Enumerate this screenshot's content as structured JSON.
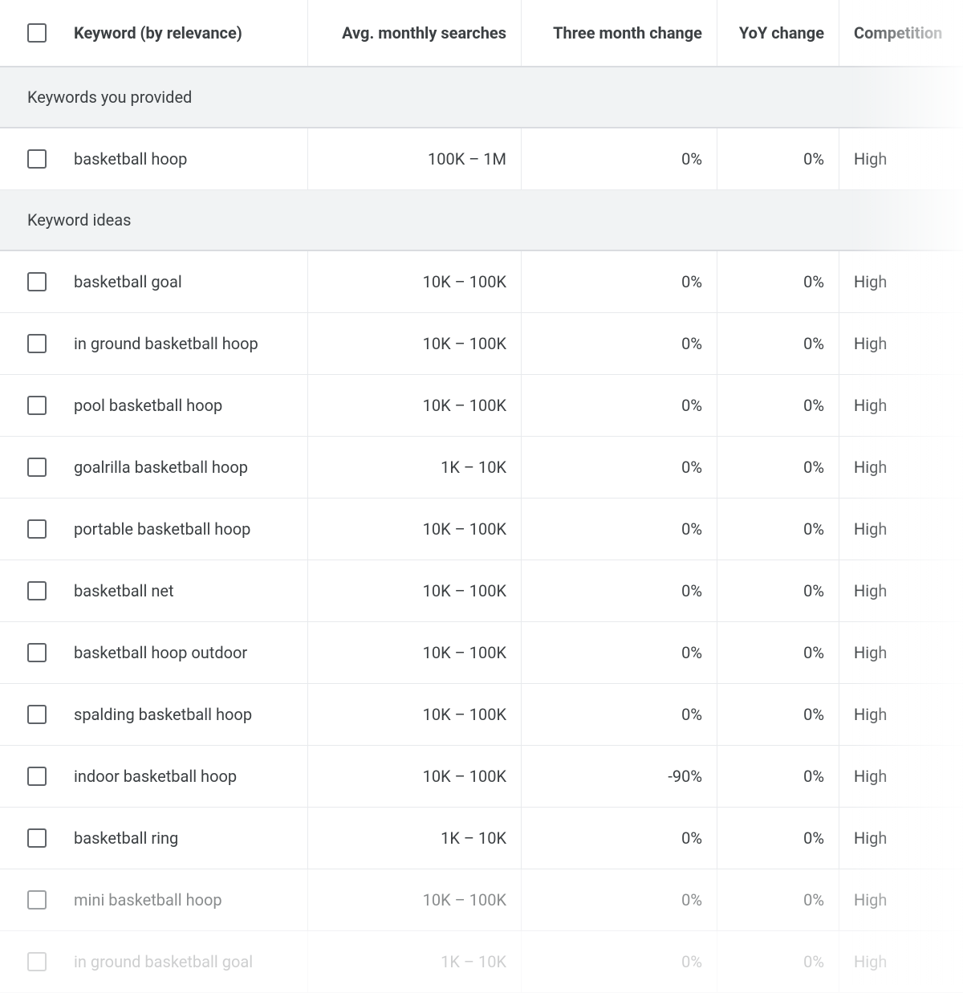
{
  "headers": {
    "keyword": "Keyword (by relevance)",
    "avg_searches": "Avg. monthly searches",
    "three_month": "Three month change",
    "yoy": "YoY change",
    "competition": "Competition"
  },
  "sections": {
    "provided": "Keywords you provided",
    "ideas": "Keyword ideas"
  },
  "provided_rows": [
    {
      "keyword": "basketball hoop",
      "avg": "100K – 1M",
      "tm": "0%",
      "yoy": "0%",
      "comp": "High"
    }
  ],
  "idea_rows": [
    {
      "keyword": "basketball goal",
      "avg": "10K – 100K",
      "tm": "0%",
      "yoy": "0%",
      "comp": "High"
    },
    {
      "keyword": "in ground basketball hoop",
      "avg": "10K – 100K",
      "tm": "0%",
      "yoy": "0%",
      "comp": "High"
    },
    {
      "keyword": "pool basketball hoop",
      "avg": "10K – 100K",
      "tm": "0%",
      "yoy": "0%",
      "comp": "High"
    },
    {
      "keyword": "goalrilla basketball hoop",
      "avg": "1K – 10K",
      "tm": "0%",
      "yoy": "0%",
      "comp": "High"
    },
    {
      "keyword": "portable basketball hoop",
      "avg": "10K – 100K",
      "tm": "0%",
      "yoy": "0%",
      "comp": "High"
    },
    {
      "keyword": "basketball net",
      "avg": "10K – 100K",
      "tm": "0%",
      "yoy": "0%",
      "comp": "High"
    },
    {
      "keyword": "basketball hoop outdoor",
      "avg": "10K – 100K",
      "tm": "0%",
      "yoy": "0%",
      "comp": "High"
    },
    {
      "keyword": "spalding basketball hoop",
      "avg": "10K – 100K",
      "tm": "0%",
      "yoy": "0%",
      "comp": "High"
    },
    {
      "keyword": "indoor basketball hoop",
      "avg": "10K – 100K",
      "tm": "-90%",
      "yoy": "0%",
      "comp": "High"
    },
    {
      "keyword": "basketball ring",
      "avg": "1K – 10K",
      "tm": "0%",
      "yoy": "0%",
      "comp": "High"
    },
    {
      "keyword": "mini basketball hoop",
      "avg": "10K – 100K",
      "tm": "0%",
      "yoy": "0%",
      "comp": "High",
      "fade": "fade1"
    },
    {
      "keyword": "in ground basketball goal",
      "avg": "1K – 10K",
      "tm": "0%",
      "yoy": "0%",
      "comp": "High",
      "fade": "fade2"
    }
  ]
}
